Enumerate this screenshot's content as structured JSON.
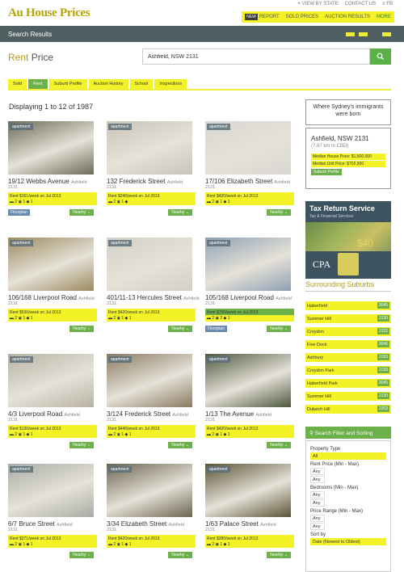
{
  "header": {
    "logo": "Au House Prices",
    "toplinks": [
      "⌖ View by State",
      "Contact Us",
      "≡ FB"
    ],
    "nav": {
      "new_badge": "NEW",
      "items": [
        "Report",
        "Sold Prices",
        "Auction Results",
        "More"
      ]
    },
    "subtitle": "Search Results"
  },
  "search": {
    "title_prefix": "Rent",
    "title_suffix": " Price",
    "value": "Ashfield, NSW 2131",
    "button_icon": "search-icon"
  },
  "tabs": [
    "Sold",
    "Rent",
    "Suburb Profile",
    "Auction History",
    "School",
    "Inspections"
  ],
  "active_tab": "Rent",
  "results": {
    "displaying": "Displaying 1 to 12 of 1987"
  },
  "listings": [
    {
      "tag": "apartment",
      "address": "19/12 Webbs Avenue",
      "suburb": "Ashfield",
      "post": "2131",
      "price": "Rent $161/week on Jul 2013",
      "beds": "2",
      "baths": "1",
      "car": "1",
      "floorplan": "Floorplan",
      "nearby": "Nearby",
      "photo": "#6c6a58"
    },
    {
      "tag": "apartment",
      "address": "132 Frederick Street",
      "suburb": "Ashfield",
      "post": "2131",
      "price": "Rent $240/week on Jul 2013",
      "beds": "2",
      "baths": "1",
      "car": "",
      "floorplan": "",
      "nearby": "Nearby",
      "photo": "#c8c4b8"
    },
    {
      "tag": "apartment",
      "address": "17/106 Elizabeth Street",
      "suburb": "Ashfield",
      "post": "2131",
      "price": "Rent $420/week on Jul 2013",
      "beds": "2",
      "baths": "1",
      "car": "1",
      "floorplan": "",
      "nearby": "Nearby",
      "photo": "#d8d6d2"
    },
    {
      "tag": "apartment",
      "address": "106/168 Liverpool Road",
      "suburb": "Ashfield",
      "post": "2131",
      "price": "Rent $530/week on Jul 2013",
      "beds": "2",
      "baths": "1",
      "car": "1",
      "floorplan": "",
      "nearby": "Nearby",
      "photo": "#9c8a60"
    },
    {
      "tag": "apartment",
      "address": "401/11-13 Hercules Street",
      "suburb": "Ashfield",
      "post": "2131",
      "price": "Rent $420/week on Jul 2013",
      "beds": "2",
      "baths": "1",
      "car": "1",
      "floorplan": "",
      "nearby": "Nearby",
      "photo": "#d2cfc6"
    },
    {
      "tag": "apartment",
      "address": "105/168 Liverpool Road",
      "suburb": "Ashfield",
      "post": "2131",
      "price": "Rent $700/week on Jul 2013",
      "beds": "2",
      "baths": "2",
      "car": "1",
      "floorplan": "Floorplan",
      "nearby": "Nearby",
      "photo": "#8ea0b4",
      "green": true
    },
    {
      "tag": "apartment",
      "address": "4/3 Liverpool Road",
      "suburb": "Ashfield",
      "post": "2131",
      "price": "Rent $130/week on Jul 2013",
      "beds": "2",
      "baths": "1",
      "car": "1",
      "floorplan": "",
      "nearby": "Nearby",
      "photo": "#b8b2a4"
    },
    {
      "tag": "apartment",
      "address": "3/124 Frederick Street",
      "suburb": "Ashfield",
      "post": "2131",
      "price": "Rent $440/week on Jul 2013",
      "beds": "2",
      "baths": "1",
      "car": "1",
      "floorplan": "",
      "nearby": "Nearby",
      "photo": "#8a7a62"
    },
    {
      "tag": "apartment",
      "address": "1/13 The Avenue",
      "suburb": "Ashfield",
      "post": "2131",
      "price": "Rent $420/week on Jul 2013",
      "beds": "2",
      "baths": "1",
      "car": "1",
      "floorplan": "",
      "nearby": "Nearby",
      "photo": "#4e5840"
    },
    {
      "tag": "apartment",
      "address": "6/7 Bruce Street",
      "suburb": "Ashfield",
      "post": "2131",
      "price": "Rent $271/week on Jul 2013",
      "beds": "2",
      "baths": "1",
      "car": "1",
      "floorplan": "",
      "nearby": "Nearby",
      "photo": "#a8aca4"
    },
    {
      "tag": "apartment",
      "address": "3/34 Elizabeth Street",
      "suburb": "Ashfield",
      "post": "2131",
      "price": "Rent $420/week on Jul 2013",
      "beds": "2",
      "baths": "1",
      "car": "1",
      "floorplan": "",
      "nearby": "Nearby",
      "photo": "#6a6450"
    },
    {
      "tag": "apartment",
      "address": "1/63 Palace Street",
      "suburb": "Ashfield",
      "post": "2131",
      "price": "Rent $380/week on Jul 2013",
      "beds": "2",
      "baths": "1",
      "car": "1",
      "floorplan": "",
      "nearby": "Nearby",
      "photo": "#5a5436"
    }
  ],
  "sidebar": {
    "promo": "Where Sydney's immigrants were born",
    "location": "Ashfield, NSW 2131",
    "distance": "(7.87 km to CBD)",
    "median_house": "Median House Price: $1,500,000",
    "median_unit": "Median Unit Price: $702,500",
    "suburb_profile": "Suburb Profile",
    "ad": {
      "title": "Tax Return Service",
      "subtitle": "Tax & Financial Services",
      "price": "$40",
      "brand": "CPA"
    },
    "surrounding_title": "Surrounding Suburbs",
    "suburbs": [
      {
        "name": "Haberfield",
        "code": "2045"
      },
      {
        "name": "Summer Hill",
        "code": "2130"
      },
      {
        "name": "Croydon",
        "code": "2132"
      },
      {
        "name": "Five Dock",
        "code": "2046"
      },
      {
        "name": "Ashbury",
        "code": "2193"
      },
      {
        "name": "Croydon Park",
        "code": "2133"
      },
      {
        "name": "Haberfield Park",
        "code": "2045"
      },
      {
        "name": "Summer Hill",
        "code": "2130"
      },
      {
        "name": "Dulwich Hill",
        "code": "2203"
      }
    ],
    "filter": {
      "title": "Search Filter and Sorting",
      "property_type_label": "Property Type",
      "property_type_value": "All",
      "rent_price_label": "Rent Price (Min - Max)",
      "bedrooms_label": "Bedrooms (Min - Max)",
      "price_range_label": "Price Range (Min - Max)",
      "any": "Any",
      "sort_label": "Sort by",
      "sort_value": "Date (Newest to Oldest)"
    }
  },
  "colors": {
    "brand_yellow": "#f2f227",
    "brand_green": "#6cb049",
    "header_dark": "#4f5f62",
    "accent_gold": "#b49a1f"
  }
}
